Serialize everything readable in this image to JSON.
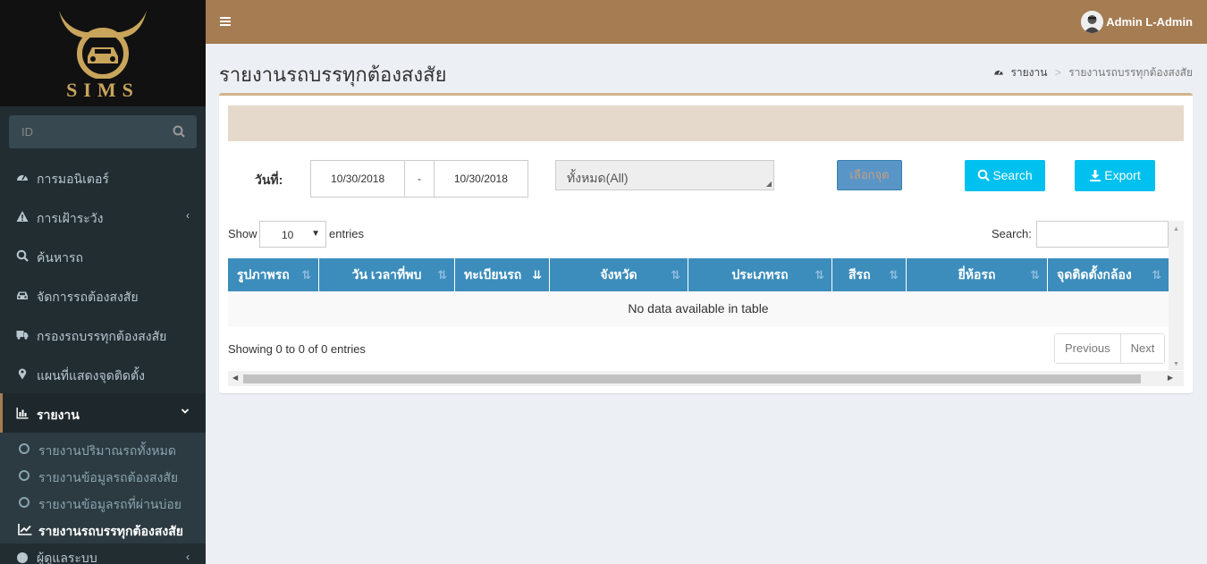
{
  "brand": {
    "name": "SIMS"
  },
  "sidebar": {
    "search_placeholder": "ID",
    "items": [
      {
        "label": "การมอนิเตอร์",
        "icon": "dashboard-icon"
      },
      {
        "label": "การเฝ้าระวัง",
        "icon": "warning-icon",
        "chevron": "‹"
      },
      {
        "label": "ค้นหารถ",
        "icon": "search-icon"
      },
      {
        "label": "จัดการรถต้องสงสัย",
        "icon": "car-icon"
      },
      {
        "label": "กรองรถบรรทุกต้องสงสัย",
        "icon": "truck-icon"
      },
      {
        "label": "แผนที่แสดงจุดติดตั้ง",
        "icon": "map-marker-icon"
      },
      {
        "label": "รายงาน",
        "icon": "bar-chart-icon",
        "chevron": "⌄",
        "active": true
      }
    ],
    "sub_items": [
      {
        "label": "รายงานปริมาณรถทั้งหมด"
      },
      {
        "label": "รายงานข้อมูลรถต้องสงสัย"
      },
      {
        "label": "รายงานข้อมูลรถที่ผ่านบ่อย"
      },
      {
        "label": "รายงานรถบรรทุกต้องสงสัย",
        "active": true
      }
    ],
    "partial_item": {
      "label": "ผู้ดูแลระบบ",
      "chevron": "‹"
    }
  },
  "header": {
    "user_name": "Admin L-Admin"
  },
  "page": {
    "title": "รายงานรถบรรทุกต้องสงสัย",
    "breadcrumb": [
      "รายงาน",
      "รายงานรถบรรทุกต้องสงสัย"
    ]
  },
  "filter": {
    "date_label": "วันที่:",
    "date_from": "10/30/2018",
    "date_sep": "-",
    "date_to": "10/30/2018",
    "location_value": "ทั้งหมด(All)",
    "pick_button": "เลือกจุด",
    "search_button": "Search",
    "export_button": "Export"
  },
  "table": {
    "show_label": "Show",
    "page_length": "10",
    "entries_label": "entries",
    "search_label": "Search:",
    "columns": [
      "รูปภาพรถ",
      "วัน เวลาที่พบ",
      "ทะเบียนรถ",
      "จังหวัด",
      "ประเภทรถ",
      "สีรถ",
      "ยี่ห้อรถ",
      "จุดติดตั้งกล้อง"
    ],
    "empty_message": "No data available in table",
    "info": "Showing 0 to 0 of 0 entries",
    "prev_label": "Previous",
    "next_label": "Next"
  },
  "colors": {
    "header": "#a67c52",
    "sidebar": "#222d32",
    "table_header": "#3c8dbc",
    "button": "#00c0ef"
  }
}
